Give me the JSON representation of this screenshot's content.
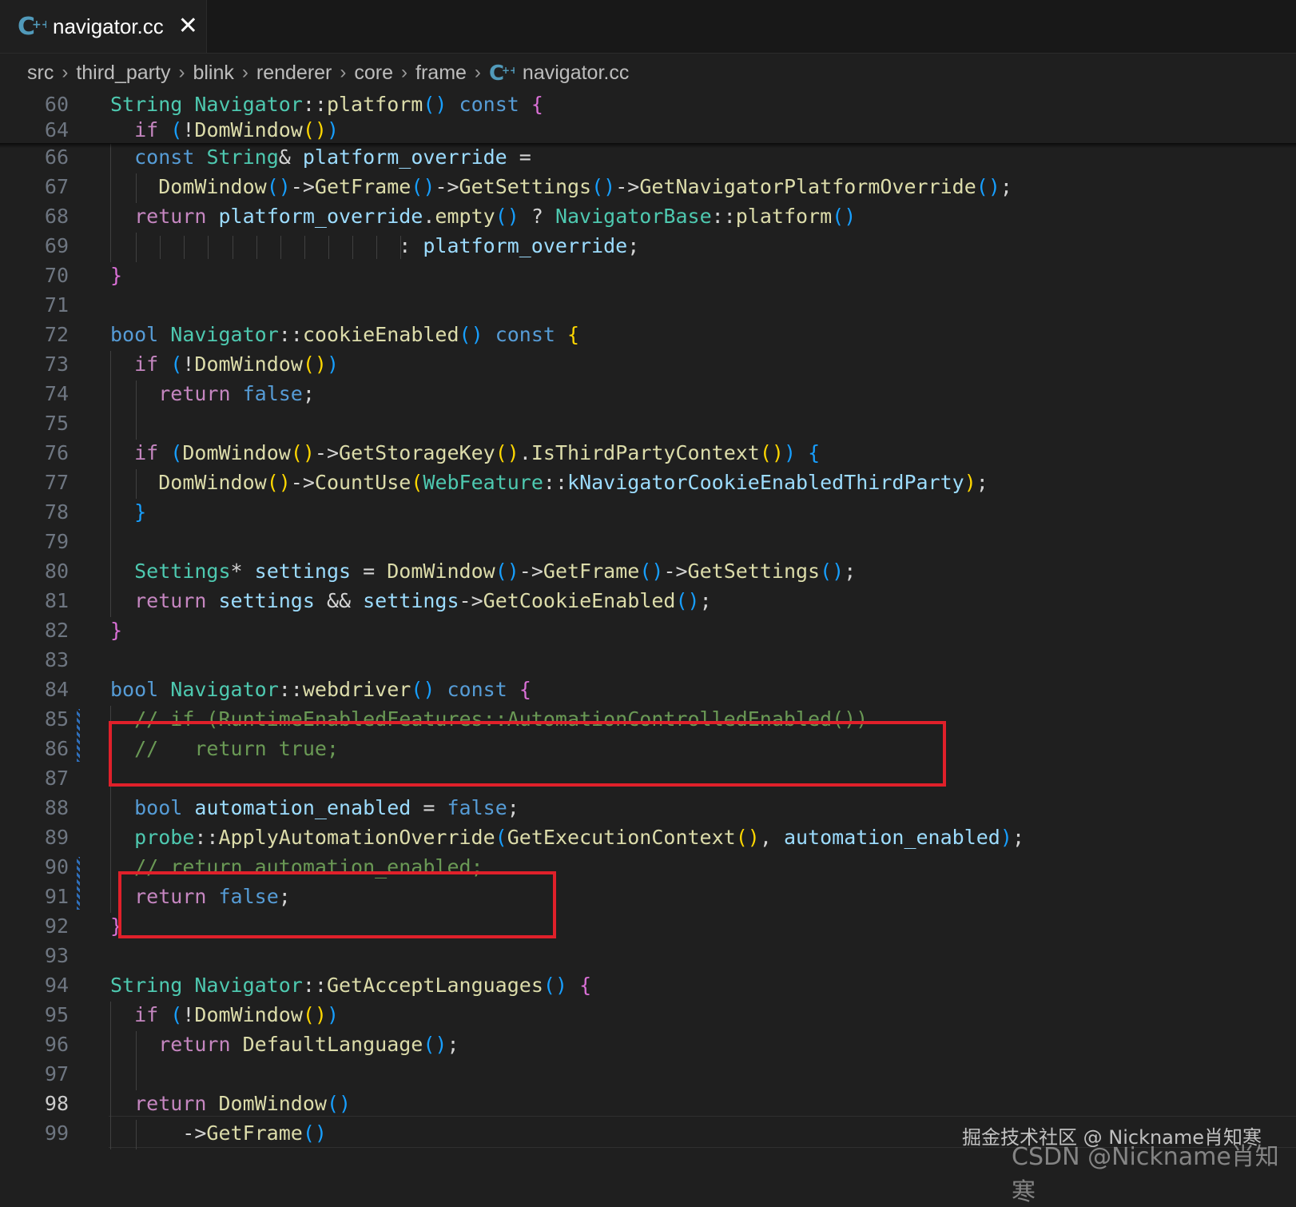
{
  "tab": {
    "icon": "cpp-file-icon",
    "title": "navigator.cc",
    "close_glyph": "✕"
  },
  "breadcrumb": {
    "items": [
      "src",
      "third_party",
      "blink",
      "renderer",
      "core",
      "frame"
    ],
    "file_icon": "cpp-file-icon",
    "file": "navigator.cc",
    "separator": "›"
  },
  "editor": {
    "current_line": "98",
    "sticky_lines": [
      {
        "num": "60",
        "indent": 0,
        "tokens": [
          [
            "t",
            "String"
          ],
          [
            "p",
            " "
          ],
          [
            "t",
            "Navigator"
          ],
          [
            "p",
            "::"
          ],
          [
            "f",
            "platform"
          ],
          [
            "b3",
            "()"
          ],
          [
            "p",
            " "
          ],
          [
            "k",
            "const"
          ],
          [
            "p",
            " "
          ],
          [
            "b2",
            "{"
          ]
        ]
      },
      {
        "num": "64",
        "indent": 1,
        "tokens": [
          [
            "c",
            "if"
          ],
          [
            "p",
            " "
          ],
          [
            "b3",
            "("
          ],
          [
            "p",
            "!"
          ],
          [
            "f",
            "DomWindow"
          ],
          [
            "b1",
            "()"
          ],
          [
            "b3",
            ")"
          ]
        ]
      }
    ],
    "lines": [
      {
        "num": "66",
        "tokens": [
          [
            "p",
            "  "
          ],
          [
            "k",
            "const"
          ],
          [
            "p",
            " "
          ],
          [
            "t",
            "String"
          ],
          [
            "p",
            "& "
          ],
          [
            "v",
            "platform_override"
          ],
          [
            "p",
            " ="
          ]
        ]
      },
      {
        "num": "67",
        "tokens": [
          [
            "p",
            "    "
          ],
          [
            "f",
            "DomWindow"
          ],
          [
            "b3",
            "()"
          ],
          [
            "p",
            "->"
          ],
          [
            "f",
            "GetFrame"
          ],
          [
            "b3",
            "()"
          ],
          [
            "p",
            "->"
          ],
          [
            "f",
            "GetSettings"
          ],
          [
            "b3",
            "()"
          ],
          [
            "p",
            "->"
          ],
          [
            "f",
            "GetNavigatorPlatformOverride"
          ],
          [
            "b3",
            "()"
          ],
          [
            "p",
            ";"
          ]
        ]
      },
      {
        "num": "68",
        "tokens": [
          [
            "p",
            "  "
          ],
          [
            "c",
            "return"
          ],
          [
            "p",
            " "
          ],
          [
            "v",
            "platform_override"
          ],
          [
            "p",
            "."
          ],
          [
            "f",
            "empty"
          ],
          [
            "b3",
            "()"
          ],
          [
            "p",
            " ? "
          ],
          [
            "t",
            "NavigatorBase"
          ],
          [
            "p",
            "::"
          ],
          [
            "f",
            "platform"
          ],
          [
            "b3",
            "()"
          ]
        ]
      },
      {
        "num": "69",
        "tokens": [
          [
            "p",
            "                        : "
          ],
          [
            "v",
            "platform_override"
          ],
          [
            "p",
            ";"
          ]
        ]
      },
      {
        "num": "70",
        "tokens": [
          [
            "b2",
            "}"
          ]
        ]
      },
      {
        "num": "71",
        "tokens": []
      },
      {
        "num": "72",
        "tokens": [
          [
            "k",
            "bool"
          ],
          [
            "p",
            " "
          ],
          [
            "t",
            "Navigator"
          ],
          [
            "p",
            "::"
          ],
          [
            "f",
            "cookieEnabled"
          ],
          [
            "b3",
            "()"
          ],
          [
            "p",
            " "
          ],
          [
            "k",
            "const"
          ],
          [
            "p",
            " "
          ],
          [
            "b1",
            "{"
          ]
        ]
      },
      {
        "num": "73",
        "tokens": [
          [
            "p",
            "  "
          ],
          [
            "c",
            "if"
          ],
          [
            "p",
            " "
          ],
          [
            "b3",
            "("
          ],
          [
            "p",
            "!"
          ],
          [
            "f",
            "DomWindow"
          ],
          [
            "b1",
            "()"
          ],
          [
            "b3",
            ")"
          ]
        ]
      },
      {
        "num": "74",
        "tokens": [
          [
            "p",
            "    "
          ],
          [
            "c",
            "return"
          ],
          [
            "p",
            " "
          ],
          [
            "k",
            "false"
          ],
          [
            "p",
            ";"
          ]
        ]
      },
      {
        "num": "75",
        "tokens": []
      },
      {
        "num": "76",
        "tokens": [
          [
            "p",
            "  "
          ],
          [
            "c",
            "if"
          ],
          [
            "p",
            " "
          ],
          [
            "b3",
            "("
          ],
          [
            "f",
            "DomWindow"
          ],
          [
            "b1",
            "()"
          ],
          [
            "p",
            "->"
          ],
          [
            "f",
            "GetStorageKey"
          ],
          [
            "b1",
            "()"
          ],
          [
            "p",
            "."
          ],
          [
            "f",
            "IsThirdPartyContext"
          ],
          [
            "b1",
            "()"
          ],
          [
            "b3",
            ")"
          ],
          [
            "p",
            " "
          ],
          [
            "b3",
            "{"
          ]
        ]
      },
      {
        "num": "77",
        "tokens": [
          [
            "p",
            "    "
          ],
          [
            "f",
            "DomWindow"
          ],
          [
            "b1",
            "()"
          ],
          [
            "p",
            "->"
          ],
          [
            "f",
            "CountUse"
          ],
          [
            "b1",
            "("
          ],
          [
            "t",
            "WebFeature"
          ],
          [
            "p",
            "::"
          ],
          [
            "v",
            "kNavigatorCookieEnabledThirdParty"
          ],
          [
            "b1",
            ")"
          ],
          [
            "p",
            ";"
          ]
        ]
      },
      {
        "num": "78",
        "tokens": [
          [
            "p",
            "  "
          ],
          [
            "b3",
            "}"
          ]
        ]
      },
      {
        "num": "79",
        "tokens": []
      },
      {
        "num": "80",
        "tokens": [
          [
            "p",
            "  "
          ],
          [
            "t",
            "Settings"
          ],
          [
            "p",
            "* "
          ],
          [
            "v",
            "settings"
          ],
          [
            "p",
            " = "
          ],
          [
            "f",
            "DomWindow"
          ],
          [
            "b3",
            "()"
          ],
          [
            "p",
            "->"
          ],
          [
            "f",
            "GetFrame"
          ],
          [
            "b3",
            "()"
          ],
          [
            "p",
            "->"
          ],
          [
            "f",
            "GetSettings"
          ],
          [
            "b3",
            "()"
          ],
          [
            "p",
            ";"
          ]
        ]
      },
      {
        "num": "81",
        "tokens": [
          [
            "p",
            "  "
          ],
          [
            "c",
            "return"
          ],
          [
            "p",
            " "
          ],
          [
            "v",
            "settings"
          ],
          [
            "p",
            " && "
          ],
          [
            "v",
            "settings"
          ],
          [
            "p",
            "->"
          ],
          [
            "f",
            "GetCookieEnabled"
          ],
          [
            "b3",
            "()"
          ],
          [
            "p",
            ";"
          ]
        ]
      },
      {
        "num": "82",
        "tokens": [
          [
            "b2",
            "}"
          ]
        ]
      },
      {
        "num": "83",
        "tokens": []
      },
      {
        "num": "84",
        "tokens": [
          [
            "k",
            "bool"
          ],
          [
            "p",
            " "
          ],
          [
            "t",
            "Navigator"
          ],
          [
            "p",
            "::"
          ],
          [
            "f",
            "webdriver"
          ],
          [
            "b3",
            "()"
          ],
          [
            "p",
            " "
          ],
          [
            "k",
            "const"
          ],
          [
            "p",
            " "
          ],
          [
            "b2",
            "{"
          ]
        ]
      },
      {
        "num": "85",
        "tokens": [
          [
            "p",
            "  "
          ],
          [
            "cm",
            "// if (RuntimeEnabledFeatures::AutomationControlledEnabled())"
          ]
        ]
      },
      {
        "num": "86",
        "tokens": [
          [
            "p",
            "  "
          ],
          [
            "cm",
            "//   return true;"
          ]
        ]
      },
      {
        "num": "87",
        "tokens": []
      },
      {
        "num": "88",
        "tokens": [
          [
            "p",
            "  "
          ],
          [
            "k",
            "bool"
          ],
          [
            "p",
            " "
          ],
          [
            "v",
            "automation_enabled"
          ],
          [
            "p",
            " = "
          ],
          [
            "k",
            "false"
          ],
          [
            "p",
            ";"
          ]
        ]
      },
      {
        "num": "89",
        "tokens": [
          [
            "p",
            "  "
          ],
          [
            "t",
            "probe"
          ],
          [
            "p",
            "::"
          ],
          [
            "f",
            "ApplyAutomationOverride"
          ],
          [
            "b3",
            "("
          ],
          [
            "f",
            "GetExecutionContext"
          ],
          [
            "b1",
            "()"
          ],
          [
            "p",
            ", "
          ],
          [
            "v",
            "automation_enabled"
          ],
          [
            "b3",
            ")"
          ],
          [
            "p",
            ";"
          ]
        ]
      },
      {
        "num": "90",
        "tokens": [
          [
            "p",
            "  "
          ],
          [
            "cm",
            "// return automation_enabled;"
          ]
        ]
      },
      {
        "num": "91",
        "tokens": [
          [
            "p",
            "  "
          ],
          [
            "c",
            "return"
          ],
          [
            "p",
            " "
          ],
          [
            "k",
            "false"
          ],
          [
            "p",
            ";"
          ]
        ]
      },
      {
        "num": "92",
        "tokens": [
          [
            "b2",
            "}"
          ]
        ]
      },
      {
        "num": "93",
        "tokens": []
      },
      {
        "num": "94",
        "tokens": [
          [
            "t",
            "String"
          ],
          [
            "p",
            " "
          ],
          [
            "t",
            "Navigator"
          ],
          [
            "p",
            "::"
          ],
          [
            "f",
            "GetAcceptLanguages"
          ],
          [
            "b3",
            "()"
          ],
          [
            "p",
            " "
          ],
          [
            "b2",
            "{"
          ]
        ]
      },
      {
        "num": "95",
        "tokens": [
          [
            "p",
            "  "
          ],
          [
            "c",
            "if"
          ],
          [
            "p",
            " "
          ],
          [
            "b3",
            "("
          ],
          [
            "p",
            "!"
          ],
          [
            "f",
            "DomWindow"
          ],
          [
            "b1",
            "()"
          ],
          [
            "b3",
            ")"
          ]
        ]
      },
      {
        "num": "96",
        "tokens": [
          [
            "p",
            "    "
          ],
          [
            "c",
            "return"
          ],
          [
            "p",
            " "
          ],
          [
            "f",
            "DefaultLanguage"
          ],
          [
            "b3",
            "()"
          ],
          [
            "p",
            ";"
          ]
        ]
      },
      {
        "num": "97",
        "tokens": []
      },
      {
        "num": "98",
        "tokens": [
          [
            "p",
            "  "
          ],
          [
            "c",
            "return"
          ],
          [
            "p",
            " "
          ],
          [
            "f",
            "DomWindow"
          ],
          [
            "b3",
            "()"
          ]
        ]
      },
      {
        "num": "99",
        "tokens": [
          [
            "p",
            "      ->"
          ],
          [
            "f",
            "GetFrame"
          ],
          [
            "b3",
            "()"
          ]
        ]
      }
    ]
  },
  "watermarks": {
    "juejin": "掘金技术社区 @ Nickname肖知寒",
    "csdn": "CSDN @Nickname肖知寒"
  },
  "colors": {
    "editor_bg": "#1f1f1f",
    "keyword": "#569cd6",
    "control": "#c586c0",
    "type": "#4ec9b0",
    "function": "#dcdcaa",
    "variable": "#9cdcfe",
    "comment": "#6a9955",
    "highlight_box": "#e0202a"
  }
}
